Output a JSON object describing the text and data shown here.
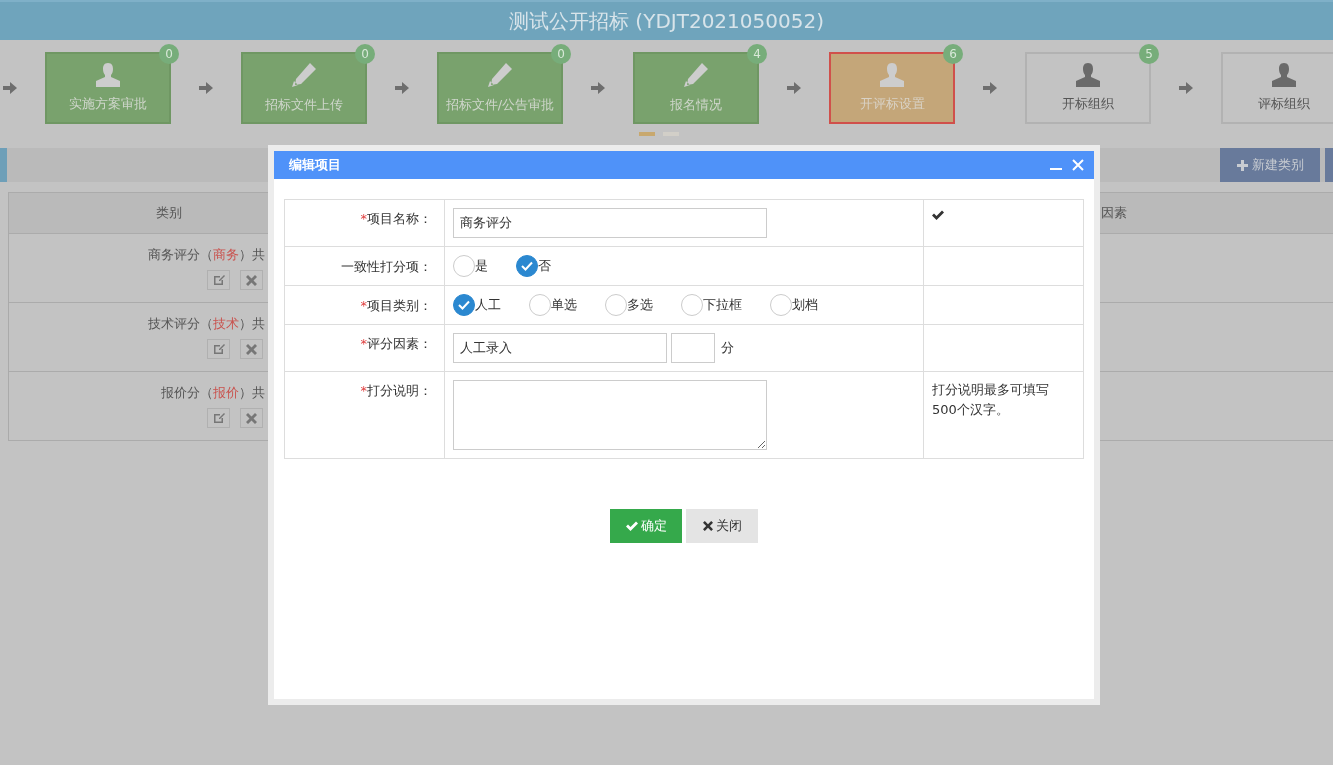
{
  "header": {
    "title": "测试公开招标 (YDJT2021050052)"
  },
  "steps": [
    {
      "label": "实施方案审批",
      "count": "0",
      "completed": true,
      "selected": false
    },
    {
      "label": "招标文件上传",
      "count": "0",
      "completed": true,
      "selected": false
    },
    {
      "label": "招标文件/公告审批",
      "count": "0",
      "completed": true,
      "selected": false
    },
    {
      "label": "报名情况",
      "count": "4",
      "completed": true,
      "selected": false
    },
    {
      "label": "开评标设置",
      "count": "6",
      "completed": false,
      "selected": true
    },
    {
      "label": "开标组织",
      "count": "5",
      "completed": false,
      "selected": false
    },
    {
      "label": "评标组织",
      "completed": false,
      "selected": false
    }
  ],
  "pager": [
    {
      "selected": true
    },
    {
      "selected": false
    }
  ],
  "toolbar": {
    "button": "新建类别"
  },
  "table": {
    "columns": [
      "类别",
      "因素"
    ],
    "rows": [
      {
        "before": "商务评分（",
        "tag": "商务",
        "after": "）共"
      },
      {
        "before": "技术评分（",
        "tag": "技术",
        "after": "）共"
      },
      {
        "before": "报价分（",
        "tag": "报价",
        "after": "）共"
      }
    ]
  },
  "dialog": {
    "title": "编辑项目",
    "fields": [
      {
        "kind": "text",
        "label": "项目名称：",
        "mark": "*",
        "value": "商务评分",
        "validated": true
      },
      {
        "kind": "radio",
        "label": "一致性打分项：",
        "options": [
          {
            "label": "是",
            "selected": false
          },
          {
            "label": "否",
            "selected": true
          }
        ]
      },
      {
        "kind": "radio",
        "label": "项目类别：",
        "mark": "*",
        "options": [
          {
            "label": "人工",
            "selected": true
          },
          {
            "label": "单选",
            "selected": false
          },
          {
            "label": "多选",
            "selected": false
          },
          {
            "label": "下拉框",
            "selected": false
          },
          {
            "label": "划档",
            "selected": false
          }
        ]
      },
      {
        "kind": "score",
        "label": "评分因素：",
        "mark": "*",
        "value": "人工录入",
        "unit": "分"
      },
      {
        "kind": "textarea",
        "label": "打分说明：",
        "mark": "*",
        "note": "打分说明最多可填写500个汉字。"
      }
    ],
    "buttons": [
      {
        "label": "确定",
        "kind": "confirm"
      },
      {
        "label": "关闭",
        "kind": "close"
      }
    ]
  }
}
